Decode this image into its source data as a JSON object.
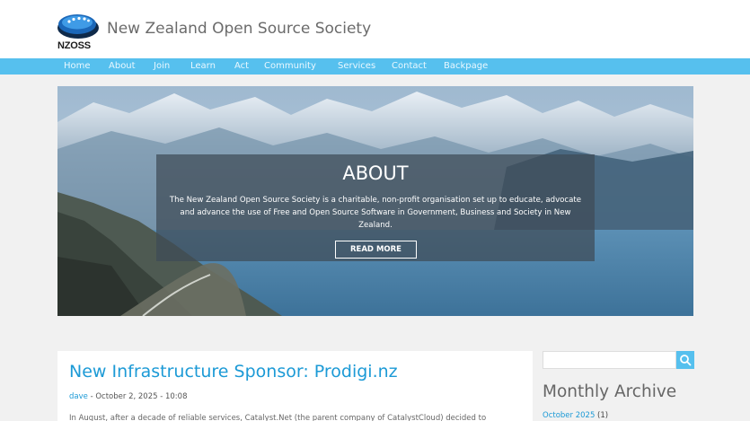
{
  "header": {
    "logo_text": "NZOSS",
    "site_title": "New Zealand Open Source Society"
  },
  "nav": {
    "items": [
      {
        "label": "Home"
      },
      {
        "label": "About"
      },
      {
        "label": "Join"
      },
      {
        "label": "Learn"
      },
      {
        "label": "Act"
      },
      {
        "label": "Community"
      },
      {
        "label": "Services"
      },
      {
        "label": "Contact"
      },
      {
        "label": "Backpage"
      }
    ]
  },
  "hero": {
    "title": "ABOUT",
    "text": "The New Zealand Open Source Society is a charitable, non-profit organisation set up to educate, advocate and advance the use of Free and Open Source Software in Government, Business and Society in New Zealand.",
    "button_label": "READ MORE"
  },
  "post": {
    "title": "New Infrastructure Sponsor: Prodigi.nz",
    "author": "dave",
    "date": " - October 2, 2025 - 10:08",
    "excerpt": "In August, after a decade of reliable services, Catalyst.Net (the parent company of CatalystCloud) decided to"
  },
  "sidebar": {
    "search_placeholder": "",
    "search_icon": "search-icon",
    "archive_title": "Monthly Archive",
    "archive_items": [
      {
        "month": "October 2025",
        "count": " (1)"
      }
    ]
  },
  "colors": {
    "nav_bar": "#56c0ee",
    "link": "#1c9ad6",
    "background": "#f1f1f1"
  }
}
